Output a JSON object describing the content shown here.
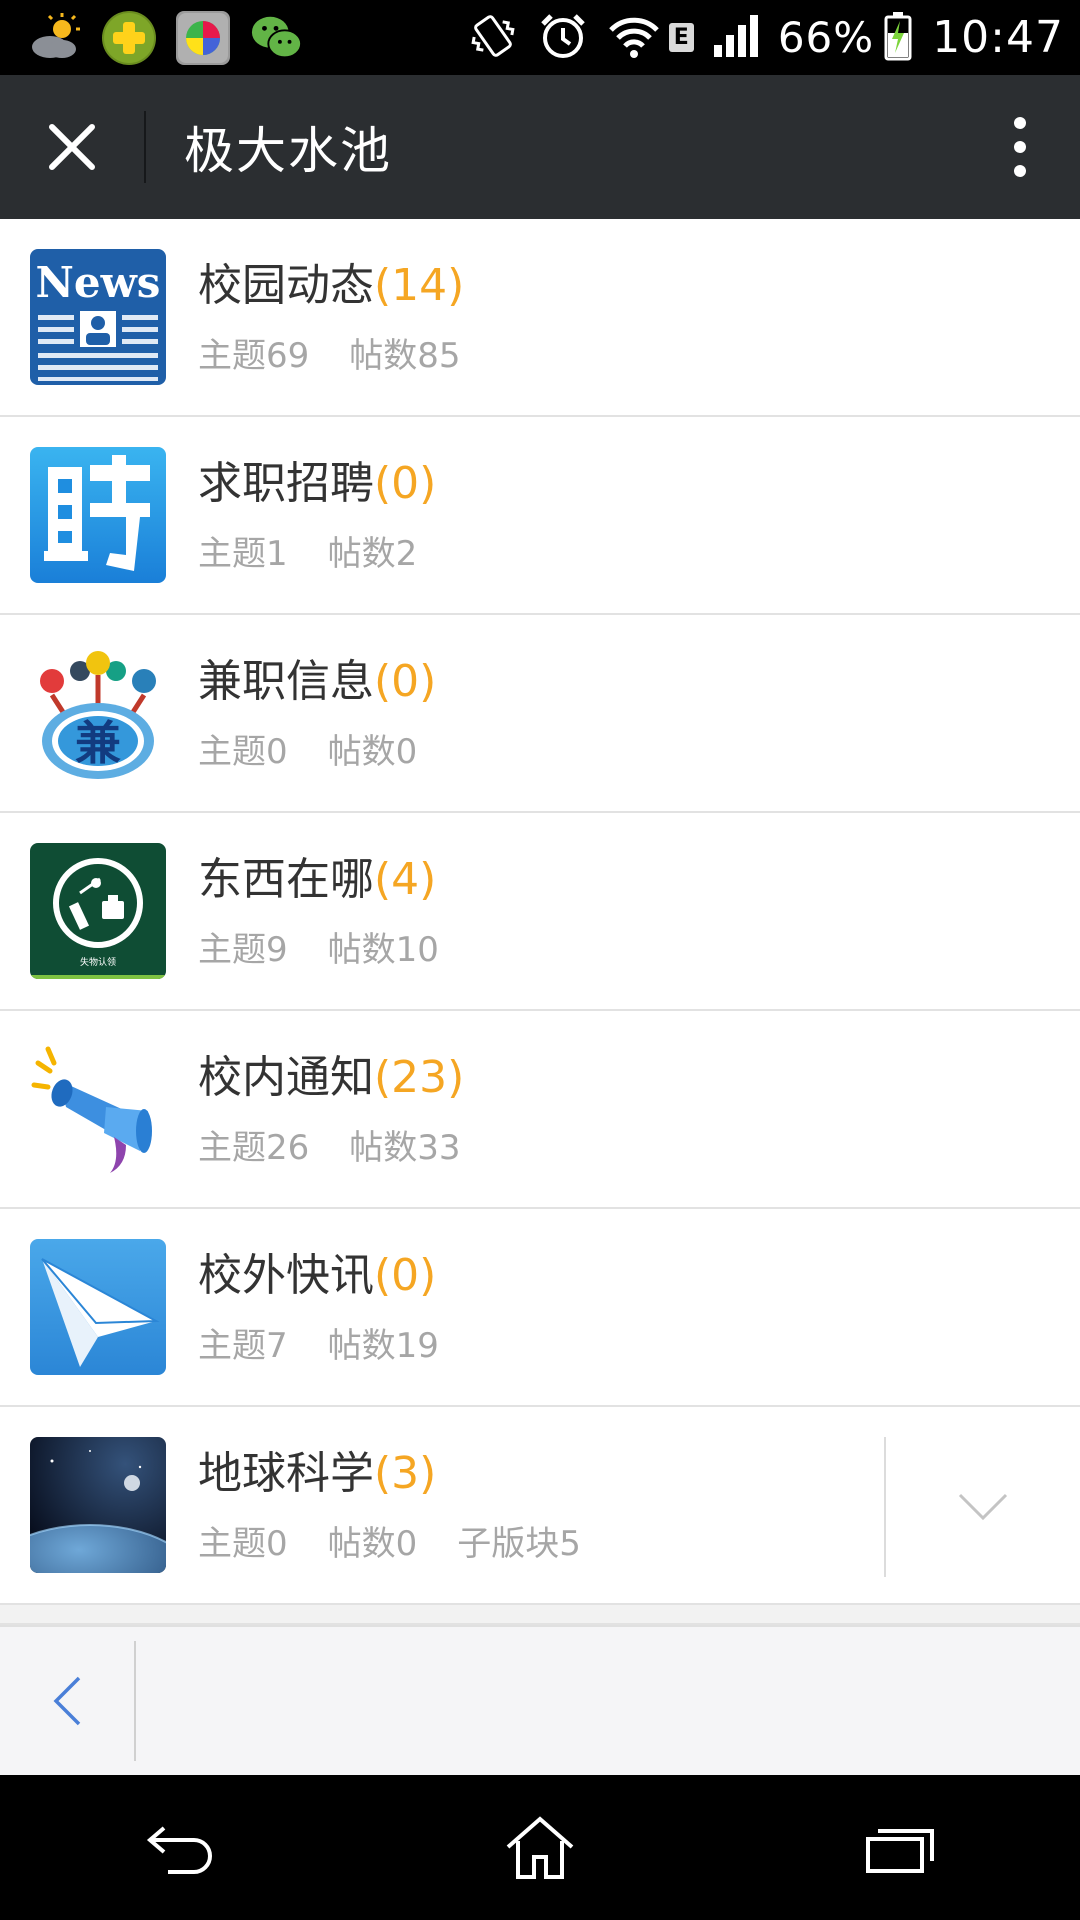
{
  "status_bar": {
    "battery": "66%",
    "time": "10:47",
    "network_type": "E",
    "left_icons": [
      "weather-icon",
      "plus-app-icon",
      "colorful-app-icon",
      "wechat-icon"
    ],
    "right_icons": [
      "vibrate-icon",
      "alarm-icon",
      "wifi-icon",
      "signal-icon",
      "battery-charging-icon"
    ]
  },
  "header": {
    "title": "极大水池",
    "close_icon": "close-icon",
    "menu_icon": "more-vert-icon"
  },
  "forums": [
    {
      "name": "校园动态",
      "count": "(14)",
      "topics": "主题69",
      "posts": "帖数85",
      "icon": "news-icon"
    },
    {
      "name": "求职招聘",
      "count": "(0)",
      "topics": "主题1",
      "posts": "帖数2",
      "icon": "recruit-icon"
    },
    {
      "name": "兼职信息",
      "count": "(0)",
      "topics": "主题0",
      "posts": "帖数0",
      "icon": "parttime-icon"
    },
    {
      "name": "东西在哪",
      "count": "(4)",
      "topics": "主题9",
      "posts": "帖数10",
      "icon": "lost-found-icon",
      "icon_caption": "失物认领"
    },
    {
      "name": "校内通知",
      "count": "(23)",
      "topics": "主题26",
      "posts": "帖数33",
      "icon": "megaphone-icon"
    },
    {
      "name": "校外快讯",
      "count": "(0)",
      "topics": "主题7",
      "posts": "帖数19",
      "icon": "paper-plane-icon"
    },
    {
      "name": "地球科学",
      "count": "(3)",
      "topics": "主题0",
      "posts": "帖数0",
      "subforums": "子版块5",
      "icon": "earth-icon"
    }
  ],
  "toolbar": {
    "back_icon": "chevron-left-icon"
  },
  "nav_bar": {
    "icons": [
      "back-icon",
      "home-icon",
      "recent-apps-icon"
    ]
  },
  "colors": {
    "header_bg": "#2b2e31",
    "count_accent": "#f5a623",
    "meta_text": "#a6a6a6",
    "title_text": "#333333"
  }
}
